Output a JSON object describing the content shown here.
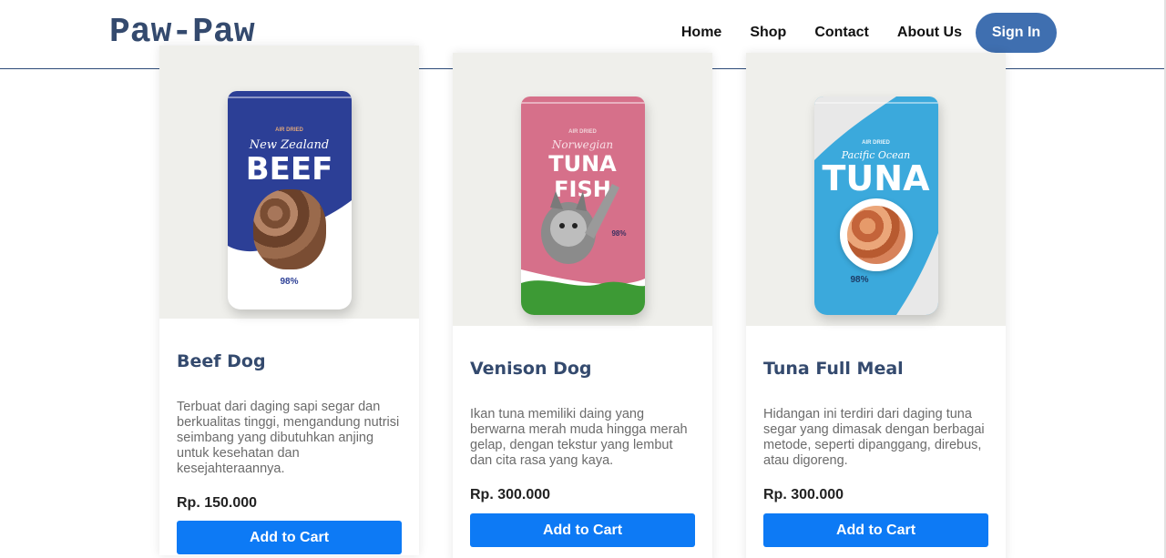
{
  "brand": "Paw-Paw",
  "nav": {
    "home": "Home",
    "shop": "Shop",
    "contact": "Contact",
    "about": "About Us",
    "signin": "Sign In"
  },
  "colors": {
    "brand_text": "#344a6e",
    "signin_bg": "#3f6fb0",
    "cart_bg": "#0d7af5"
  },
  "products": [
    {
      "name": "Beef Dog",
      "description": "Terbuat dari daging sapi segar dan berkualitas tinggi, mengandung nutrisi seimbang yang dibutuhkan anjing untuk kesehatan dan kesejahteraannya.",
      "price": "Rp. 150.000",
      "cart_label": "Add to Cart",
      "pouch": {
        "small": "AIR DRIED",
        "script": "New Zealand",
        "big": "BEEF",
        "pct": "98%"
      }
    },
    {
      "name": "Venison Dog",
      "description": "Ikan tuna memiliki daing yang berwarna merah muda hingga merah gelap, dengan tekstur yang lembut dan cita rasa yang kaya.",
      "price": "Rp. 300.000",
      "cart_label": "Add to Cart",
      "pouch": {
        "small": "AIR DRIED",
        "script": "Norwegian",
        "big": "TUNA FISH",
        "pct": "98%"
      }
    },
    {
      "name": "Tuna Full Meal",
      "description": "Hidangan ini terdiri dari daging tuna segar yang dimasak dengan berbagai metode, seperti dipanggang, direbus, atau digoreng.",
      "price": "Rp. 300.000",
      "cart_label": "Add to Cart",
      "pouch": {
        "small": "AIR DRIED",
        "script": "Pacific Ocean",
        "big": "TUNA",
        "pct": "98%"
      }
    }
  ]
}
